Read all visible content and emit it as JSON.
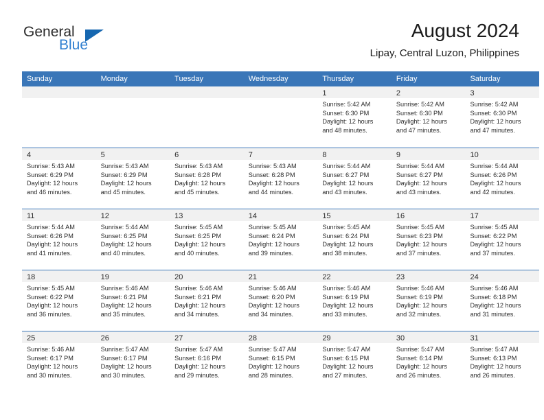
{
  "brand": {
    "name_part1": "General",
    "name_part2": "Blue",
    "logo_icon": "triangle-logo-icon",
    "accent_color": "#1667b0",
    "blue_text_color": "#2f7fd0"
  },
  "header": {
    "title": "August 2024",
    "subtitle": "Lipay, Central Luzon, Philippines"
  },
  "calendar": {
    "header_bg": "#3a76b8",
    "day_band_bg": "#f1f1f1",
    "weekdays": [
      "Sunday",
      "Monday",
      "Tuesday",
      "Wednesday",
      "Thursday",
      "Friday",
      "Saturday"
    ],
    "weeks": [
      [
        {
          "empty": true
        },
        {
          "empty": true
        },
        {
          "empty": true
        },
        {
          "empty": true
        },
        {
          "day": "1",
          "sunrise": "Sunrise: 5:42 AM",
          "sunset": "Sunset: 6:30 PM",
          "daylight1": "Daylight: 12 hours",
          "daylight2": "and 48 minutes."
        },
        {
          "day": "2",
          "sunrise": "Sunrise: 5:42 AM",
          "sunset": "Sunset: 6:30 PM",
          "daylight1": "Daylight: 12 hours",
          "daylight2": "and 47 minutes."
        },
        {
          "day": "3",
          "sunrise": "Sunrise: 5:42 AM",
          "sunset": "Sunset: 6:30 PM",
          "daylight1": "Daylight: 12 hours",
          "daylight2": "and 47 minutes."
        }
      ],
      [
        {
          "day": "4",
          "sunrise": "Sunrise: 5:43 AM",
          "sunset": "Sunset: 6:29 PM",
          "daylight1": "Daylight: 12 hours",
          "daylight2": "and 46 minutes."
        },
        {
          "day": "5",
          "sunrise": "Sunrise: 5:43 AM",
          "sunset": "Sunset: 6:29 PM",
          "daylight1": "Daylight: 12 hours",
          "daylight2": "and 45 minutes."
        },
        {
          "day": "6",
          "sunrise": "Sunrise: 5:43 AM",
          "sunset": "Sunset: 6:28 PM",
          "daylight1": "Daylight: 12 hours",
          "daylight2": "and 45 minutes."
        },
        {
          "day": "7",
          "sunrise": "Sunrise: 5:43 AM",
          "sunset": "Sunset: 6:28 PM",
          "daylight1": "Daylight: 12 hours",
          "daylight2": "and 44 minutes."
        },
        {
          "day": "8",
          "sunrise": "Sunrise: 5:44 AM",
          "sunset": "Sunset: 6:27 PM",
          "daylight1": "Daylight: 12 hours",
          "daylight2": "and 43 minutes."
        },
        {
          "day": "9",
          "sunrise": "Sunrise: 5:44 AM",
          "sunset": "Sunset: 6:27 PM",
          "daylight1": "Daylight: 12 hours",
          "daylight2": "and 43 minutes."
        },
        {
          "day": "10",
          "sunrise": "Sunrise: 5:44 AM",
          "sunset": "Sunset: 6:26 PM",
          "daylight1": "Daylight: 12 hours",
          "daylight2": "and 42 minutes."
        }
      ],
      [
        {
          "day": "11",
          "sunrise": "Sunrise: 5:44 AM",
          "sunset": "Sunset: 6:26 PM",
          "daylight1": "Daylight: 12 hours",
          "daylight2": "and 41 minutes."
        },
        {
          "day": "12",
          "sunrise": "Sunrise: 5:44 AM",
          "sunset": "Sunset: 6:25 PM",
          "daylight1": "Daylight: 12 hours",
          "daylight2": "and 40 minutes."
        },
        {
          "day": "13",
          "sunrise": "Sunrise: 5:45 AM",
          "sunset": "Sunset: 6:25 PM",
          "daylight1": "Daylight: 12 hours",
          "daylight2": "and 40 minutes."
        },
        {
          "day": "14",
          "sunrise": "Sunrise: 5:45 AM",
          "sunset": "Sunset: 6:24 PM",
          "daylight1": "Daylight: 12 hours",
          "daylight2": "and 39 minutes."
        },
        {
          "day": "15",
          "sunrise": "Sunrise: 5:45 AM",
          "sunset": "Sunset: 6:24 PM",
          "daylight1": "Daylight: 12 hours",
          "daylight2": "and 38 minutes."
        },
        {
          "day": "16",
          "sunrise": "Sunrise: 5:45 AM",
          "sunset": "Sunset: 6:23 PM",
          "daylight1": "Daylight: 12 hours",
          "daylight2": "and 37 minutes."
        },
        {
          "day": "17",
          "sunrise": "Sunrise: 5:45 AM",
          "sunset": "Sunset: 6:22 PM",
          "daylight1": "Daylight: 12 hours",
          "daylight2": "and 37 minutes."
        }
      ],
      [
        {
          "day": "18",
          "sunrise": "Sunrise: 5:45 AM",
          "sunset": "Sunset: 6:22 PM",
          "daylight1": "Daylight: 12 hours",
          "daylight2": "and 36 minutes."
        },
        {
          "day": "19",
          "sunrise": "Sunrise: 5:46 AM",
          "sunset": "Sunset: 6:21 PM",
          "daylight1": "Daylight: 12 hours",
          "daylight2": "and 35 minutes."
        },
        {
          "day": "20",
          "sunrise": "Sunrise: 5:46 AM",
          "sunset": "Sunset: 6:21 PM",
          "daylight1": "Daylight: 12 hours",
          "daylight2": "and 34 minutes."
        },
        {
          "day": "21",
          "sunrise": "Sunrise: 5:46 AM",
          "sunset": "Sunset: 6:20 PM",
          "daylight1": "Daylight: 12 hours",
          "daylight2": "and 34 minutes."
        },
        {
          "day": "22",
          "sunrise": "Sunrise: 5:46 AM",
          "sunset": "Sunset: 6:19 PM",
          "daylight1": "Daylight: 12 hours",
          "daylight2": "and 33 minutes."
        },
        {
          "day": "23",
          "sunrise": "Sunrise: 5:46 AM",
          "sunset": "Sunset: 6:19 PM",
          "daylight1": "Daylight: 12 hours",
          "daylight2": "and 32 minutes."
        },
        {
          "day": "24",
          "sunrise": "Sunrise: 5:46 AM",
          "sunset": "Sunset: 6:18 PM",
          "daylight1": "Daylight: 12 hours",
          "daylight2": "and 31 minutes."
        }
      ],
      [
        {
          "day": "25",
          "sunrise": "Sunrise: 5:46 AM",
          "sunset": "Sunset: 6:17 PM",
          "daylight1": "Daylight: 12 hours",
          "daylight2": "and 30 minutes."
        },
        {
          "day": "26",
          "sunrise": "Sunrise: 5:47 AM",
          "sunset": "Sunset: 6:17 PM",
          "daylight1": "Daylight: 12 hours",
          "daylight2": "and 30 minutes."
        },
        {
          "day": "27",
          "sunrise": "Sunrise: 5:47 AM",
          "sunset": "Sunset: 6:16 PM",
          "daylight1": "Daylight: 12 hours",
          "daylight2": "and 29 minutes."
        },
        {
          "day": "28",
          "sunrise": "Sunrise: 5:47 AM",
          "sunset": "Sunset: 6:15 PM",
          "daylight1": "Daylight: 12 hours",
          "daylight2": "and 28 minutes."
        },
        {
          "day": "29",
          "sunrise": "Sunrise: 5:47 AM",
          "sunset": "Sunset: 6:15 PM",
          "daylight1": "Daylight: 12 hours",
          "daylight2": "and 27 minutes."
        },
        {
          "day": "30",
          "sunrise": "Sunrise: 5:47 AM",
          "sunset": "Sunset: 6:14 PM",
          "daylight1": "Daylight: 12 hours",
          "daylight2": "and 26 minutes."
        },
        {
          "day": "31",
          "sunrise": "Sunrise: 5:47 AM",
          "sunset": "Sunset: 6:13 PM",
          "daylight1": "Daylight: 12 hours",
          "daylight2": "and 26 minutes."
        }
      ]
    ]
  }
}
